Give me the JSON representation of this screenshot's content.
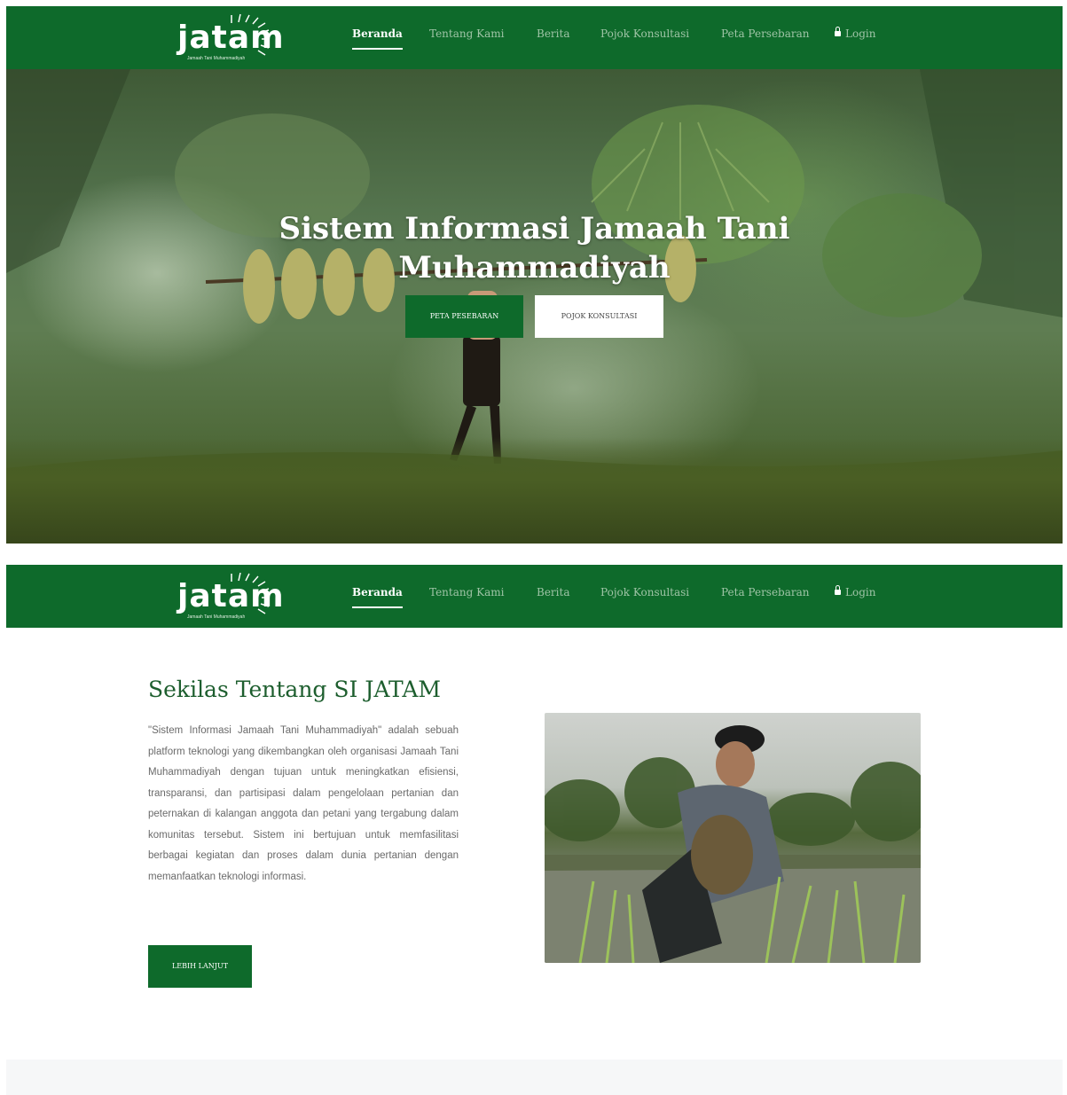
{
  "brand": {
    "logo_text": "jatam",
    "logo_tagline": "Jamaah Tani Muhammadiyah",
    "primary_color": "#0e6a2b",
    "hero_tint": "#4f6a3a"
  },
  "nav": {
    "items": [
      {
        "label": "Beranda",
        "active": true
      },
      {
        "label": "Tentang Kami",
        "active": false
      },
      {
        "label": "Berita",
        "active": false
      },
      {
        "label": "Pojok Konsultasi",
        "active": false
      },
      {
        "label": "Peta Persebaran",
        "active": false
      },
      {
        "label": "Login",
        "icon": "lock-icon",
        "active": false
      }
    ]
  },
  "hero": {
    "title_line1": "Sistem Informasi Jamaah Tani",
    "title_line2": "Muhammadiyah",
    "btn_peta": "PETA PESEBARAN",
    "btn_pojok": "POJOK KONSULTASI"
  },
  "about": {
    "title": "Sekilas Tentang SI JATAM",
    "paragraph": "\"Sistem Informasi Jamaah Tani Muhammadiyah\" adalah sebuah platform teknologi yang dikembangkan oleh organisasi Jamaah Tani Muhammadiyah dengan tujuan untuk meningkatkan efisiensi, transparansi, dan partisipasi dalam pengelolaan pertanian dan peternakan di kalangan anggota dan petani yang tergabung dalam komunitas tersebut. Sistem ini bertujuan untuk memfasilitasi berbagai kegiatan dan proses dalam dunia pertanian dengan memanfaatkan teknologi informasi.",
    "button": "LEBIH LANJUT"
  }
}
